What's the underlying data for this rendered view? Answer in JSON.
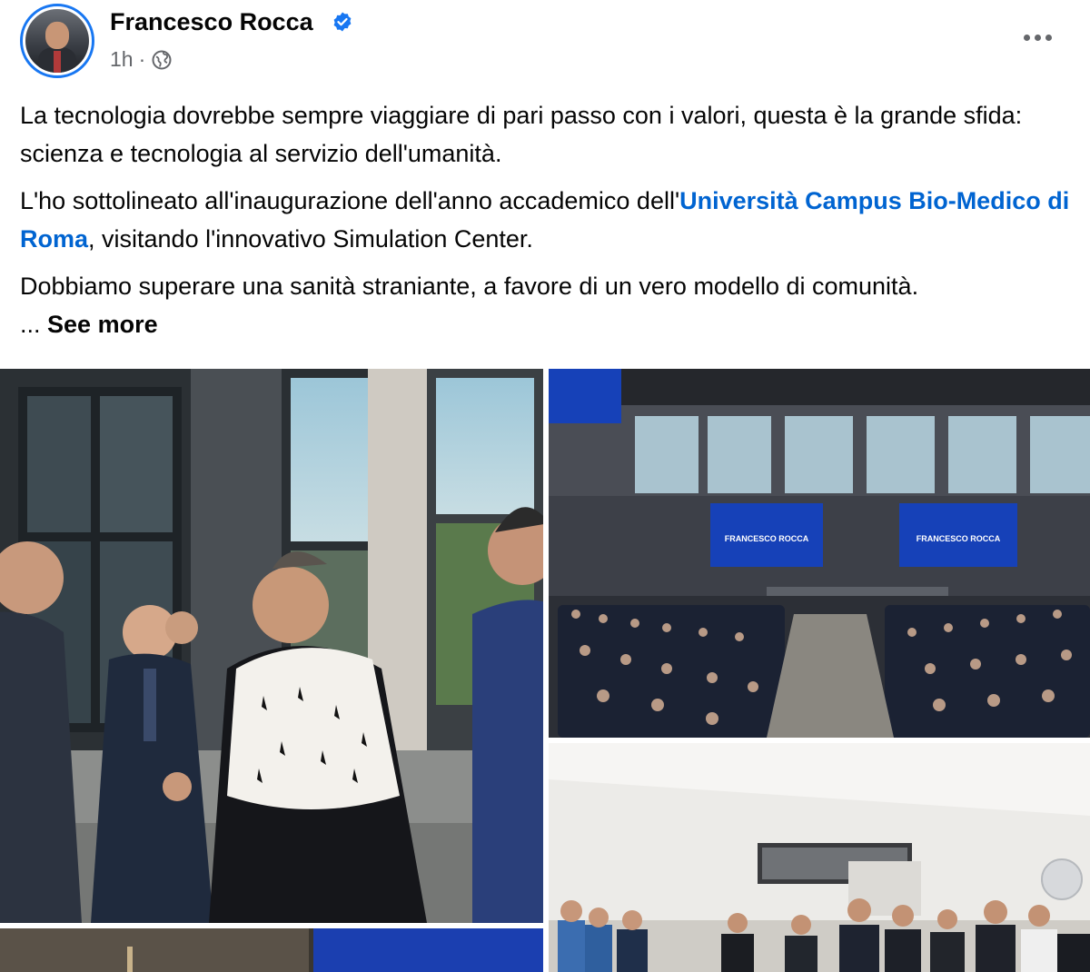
{
  "author": {
    "name": "Francesco Rocca",
    "avatar_icon": "profile-photo",
    "verified_icon": "verified-badge-icon"
  },
  "meta": {
    "time": "1h",
    "separator": "·",
    "audience_icon": "globe-icon"
  },
  "post": {
    "paragraph1": "La tecnologia dovrebbe sempre viaggiare di pari passo con i valori, questa è la grande sfida: scienza e tecnologia al servizio dell'umanità.",
    "paragraph2_before": "L'ho sottolineato all'inaugurazione dell'anno accademico dell'",
    "paragraph2_link": "Università Campus Bio-Medico di Roma",
    "paragraph2_after": ", visitando l'innovativo Simulation Center.",
    "paragraph3": "Dobbiamo superare una sanità straniante, a favore di un vero modello di comunità.",
    "ellipsis": "...",
    "see_more": "See more"
  },
  "photos": {
    "screen_text": "FRANCESCO ROCCA"
  },
  "colors": {
    "link": "#0064d1",
    "verified": "#1877f2",
    "secondary_text": "#65676b"
  }
}
